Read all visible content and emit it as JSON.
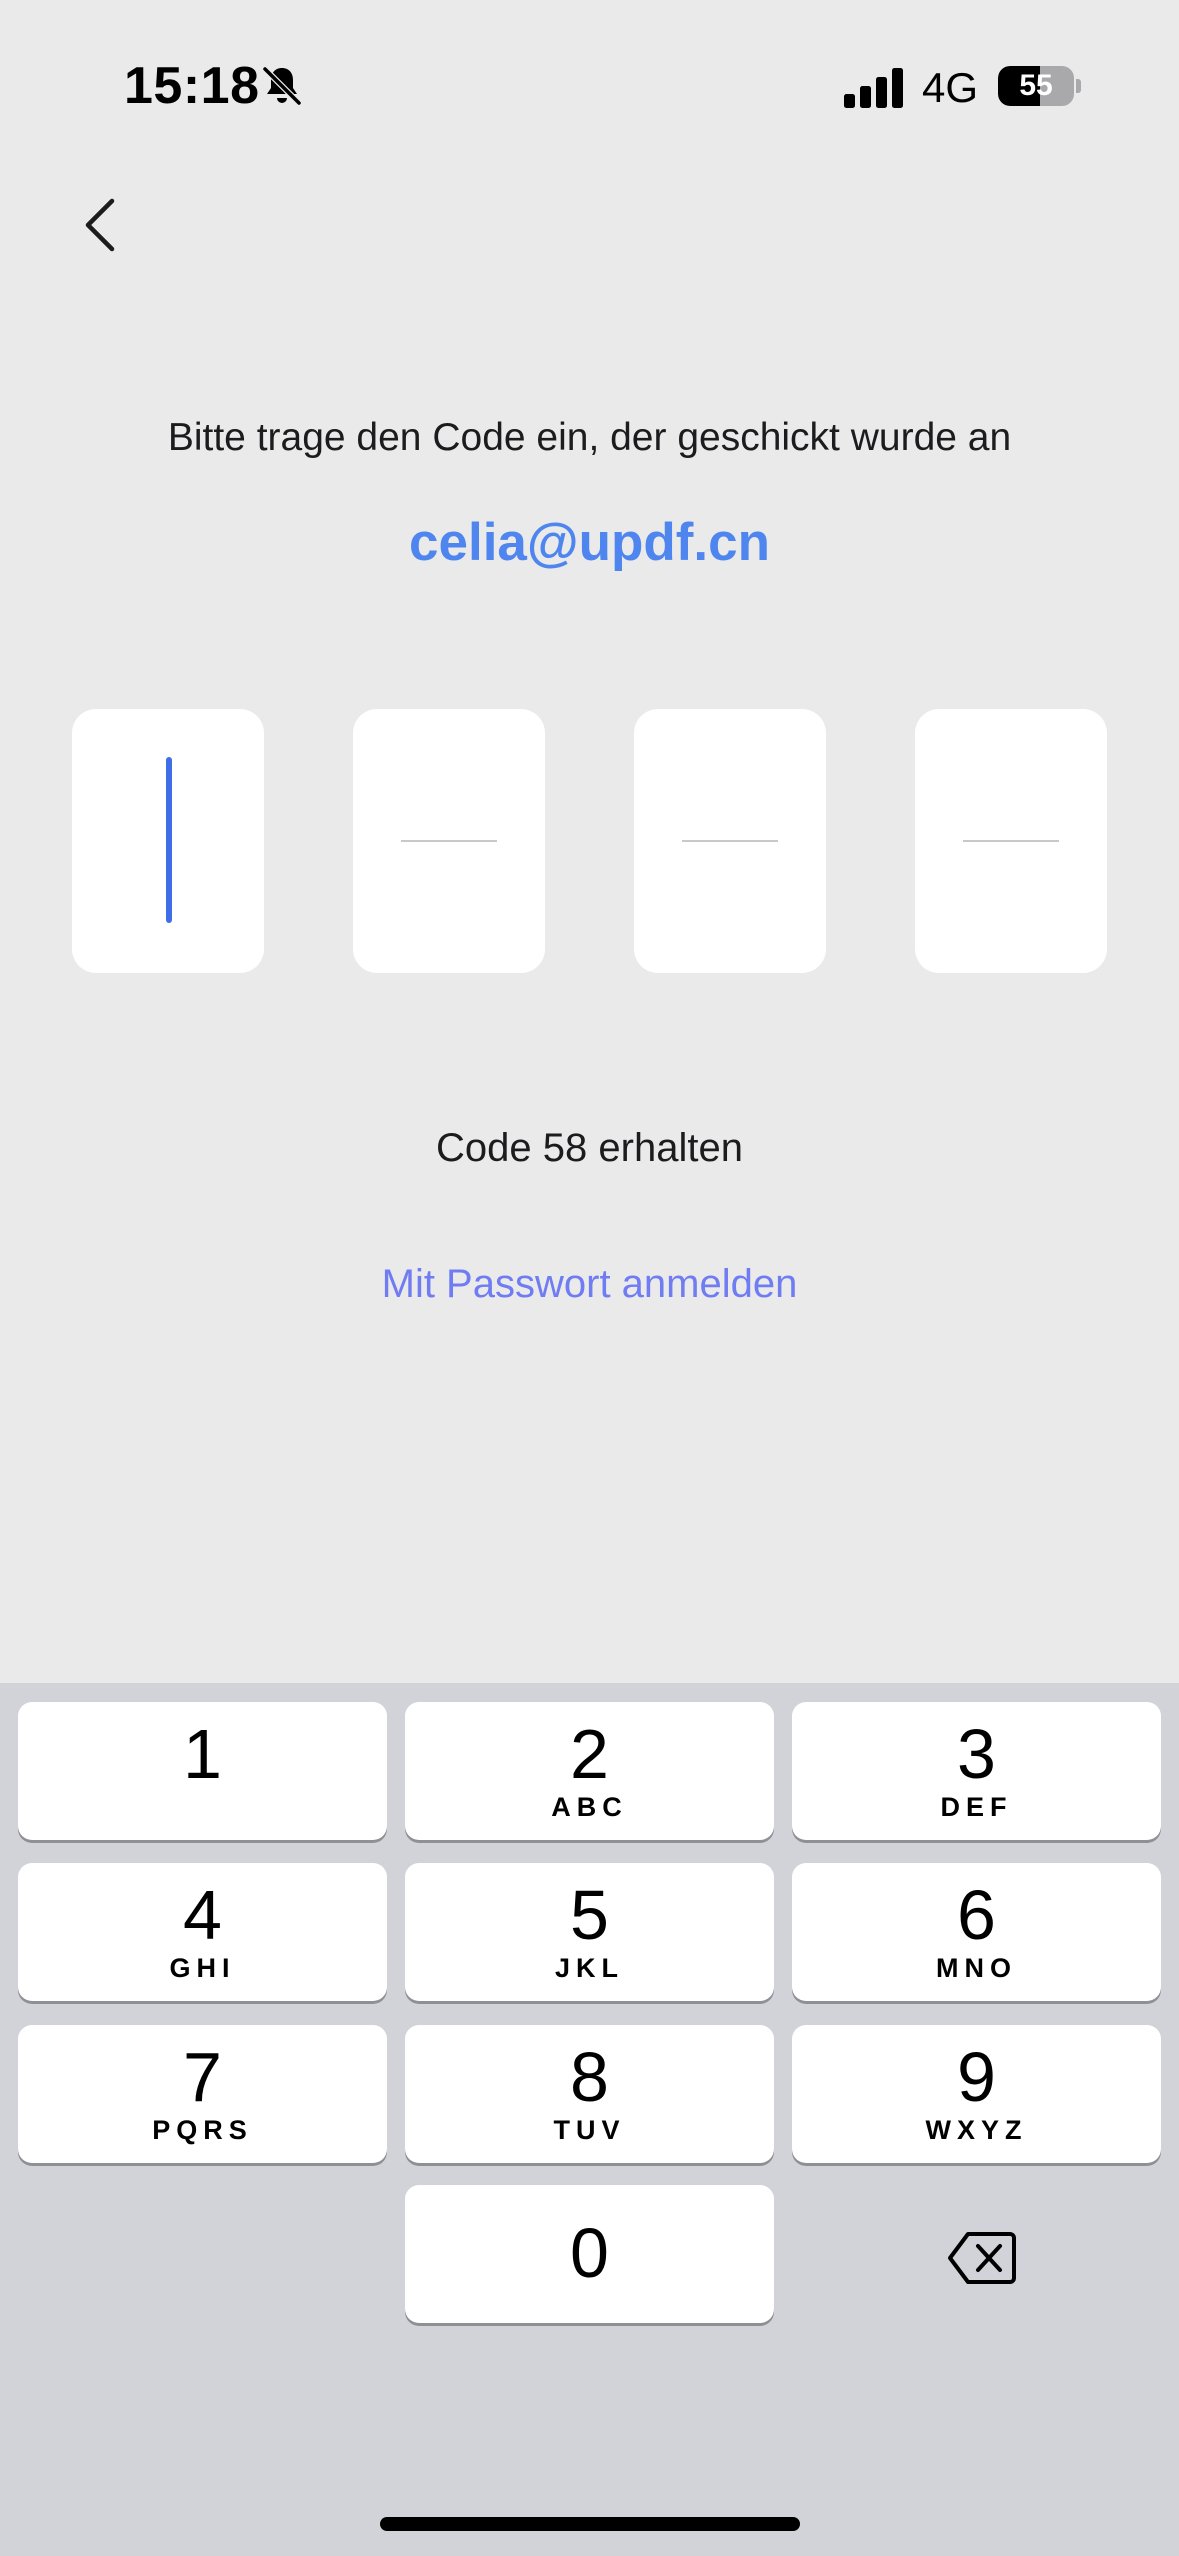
{
  "status_bar": {
    "time": "15:18",
    "network": "4G",
    "battery_level": "55",
    "battery_fraction": 0.55,
    "icons": [
      "bell-slash-icon",
      "cellular-signal-icon",
      "battery-icon"
    ]
  },
  "header": {
    "back_icon": "chevron-left-icon"
  },
  "verification": {
    "instruction": "Bitte trage den Code ein, der geschickt wurde an",
    "email": "celia@updf.cn",
    "code_digits": [
      "",
      "",
      "",
      ""
    ],
    "resend_info": "Code 58 erhalten",
    "password_login_link": "Mit Passwort anmelden"
  },
  "colors": {
    "background": "#eaeaeb",
    "email_accent": "#4f85ee",
    "link_accent": "#6f7cf2",
    "cursor": "#3f6fe6",
    "keyboard_background": "#d1d3d9"
  },
  "keypad": {
    "keys": [
      {
        "number": "1",
        "letters": ""
      },
      {
        "number": "2",
        "letters": "ABC"
      },
      {
        "number": "3",
        "letters": "DEF"
      },
      {
        "number": "4",
        "letters": "GHI"
      },
      {
        "number": "5",
        "letters": "JKL"
      },
      {
        "number": "6",
        "letters": "MNO"
      },
      {
        "number": "7",
        "letters": "PQRS"
      },
      {
        "number": "8",
        "letters": "TUV"
      },
      {
        "number": "9",
        "letters": "WXYZ"
      },
      {
        "number": "0",
        "letters": ""
      }
    ],
    "delete_icon": "backspace-icon"
  }
}
